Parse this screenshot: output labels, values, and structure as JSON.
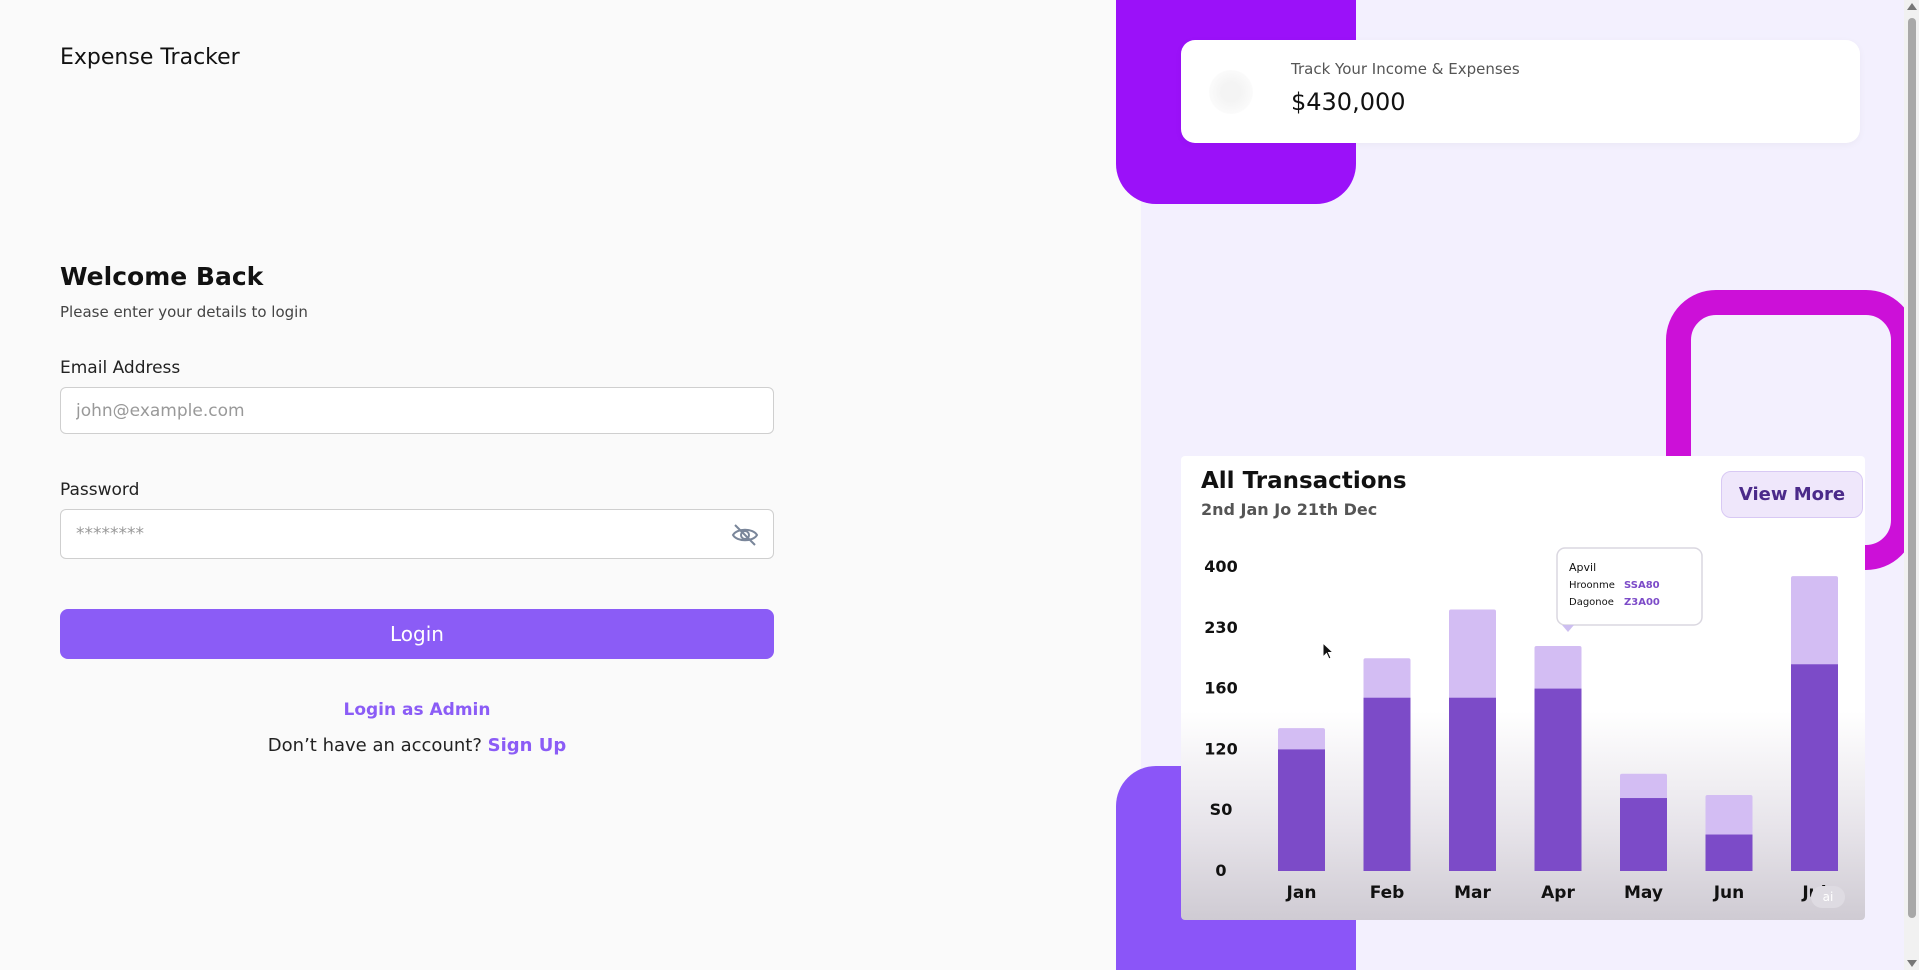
{
  "brand": {
    "title": "Expense Tracker"
  },
  "login": {
    "heading": "Welcome Back",
    "subtitle": "Please enter your details to login",
    "email_label": "Email Address",
    "email_placeholder": "john@example.com",
    "email_value": "",
    "password_label": "Password",
    "password_placeholder": "********",
    "password_value": "",
    "submit_label": "Login",
    "admin_link": "Login as Admin",
    "signup_prompt": "Don’t have an account?",
    "signup_link": "Sign Up"
  },
  "stat_card": {
    "label": "Track Your Income & Expenses",
    "value": "$430,000"
  },
  "transactions": {
    "title": "All Transactions",
    "subtitle": "2nd Jan Jo 21th Dec",
    "view_more": "View More",
    "tooltip": {
      "title": "Apvil",
      "line1_label": "Hroonme",
      "line1_value": "SSA80",
      "line2_label": "Dagonoe",
      "line2_value": "Z3A00"
    },
    "badge": "ai"
  },
  "chart_data": {
    "type": "bar",
    "categories": [
      "Jan",
      "Feb",
      "Mar",
      "Apr",
      "May",
      "Jun",
      "Jul"
    ],
    "y_tick_labels": [
      "0",
      "S0",
      "120",
      "160",
      "230",
      "400"
    ],
    "series": [
      {
        "values": [
          0.4,
          0.57,
          0.57,
          0.6,
          0.24,
          0.12,
          0.68
        ]
      },
      {
        "values": [
          0.47,
          0.7,
          0.86,
          0.74,
          0.32,
          0.25,
          0.97
        ]
      }
    ],
    "grid": false,
    "colors": {
      "dark": "#7c4bc8",
      "light": "#d3bdf3"
    }
  },
  "colors": {
    "accent": "#8b5cf6",
    "shape_purple": "#9b11f9",
    "shape_magenta": "#cc10d8",
    "shape_violet": "#8b55f8"
  }
}
